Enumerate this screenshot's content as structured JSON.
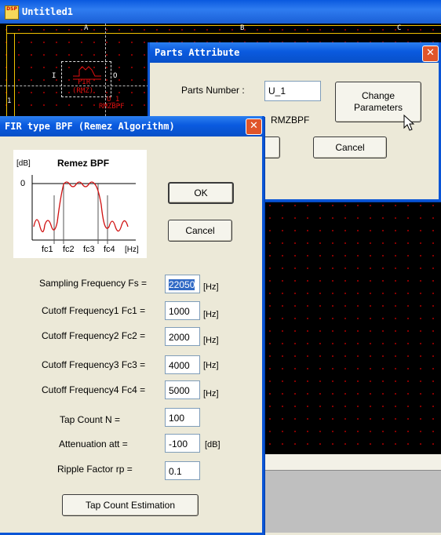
{
  "main_window": {
    "title": "Untitled1",
    "app_icon_text": "DSP",
    "ruler_columns": [
      "A",
      "B",
      "C"
    ],
    "ruler_rows": [
      "1"
    ],
    "part": {
      "pin_in": "I",
      "pin_out": "O",
      "name": "FIR",
      "sub": "(RMZ)",
      "ref": "U_1",
      "type": "RMZBPF"
    }
  },
  "parts_attribute": {
    "title": "Parts Attribute",
    "parts_number_label": "Parts Number :",
    "parts_number_value": "U_1",
    "part_type": "RMZBPF",
    "change_parameters_line1": "Change",
    "change_parameters_line2": "Parameters",
    "cancel_label": "Cancel"
  },
  "fir_dialog": {
    "title": "FIR type BPF (Remez Algorithm)",
    "graph": {
      "title": "Remez BPF",
      "y_unit": "[dB]",
      "zero_label": "0",
      "x_labels": [
        "fc1",
        "fc2",
        "fc3",
        "fc4"
      ],
      "x_unit": "[Hz]"
    },
    "ok_label": "OK",
    "cancel_label": "Cancel",
    "fields": [
      {
        "label": "Sampling Frequency Fs =",
        "value": "22050",
        "unit": "[Hz]"
      },
      {
        "label": "Cutoff Frequency1 Fc1 =",
        "value": "1000",
        "unit": "[Hz]"
      },
      {
        "label": "Cutoff Frequency2 Fc2 =",
        "value": "2000",
        "unit": "[Hz]"
      },
      {
        "label": "Cutoff Frequency3 Fc3 =",
        "value": "4000",
        "unit": "[Hz]"
      },
      {
        "label": "Cutoff Frequency4 Fc4 =",
        "value": "5000",
        "unit": "[Hz]"
      },
      {
        "label": "Tap Count N =",
        "value": "100",
        "unit": ""
      },
      {
        "label": "Attenuation att =",
        "value": "-100",
        "unit": "[dB]"
      },
      {
        "label": "Ripple Factor rp =",
        "value": "0.1",
        "unit": ""
      }
    ],
    "tap_estimation_label": "Tap Count Estimation"
  }
}
